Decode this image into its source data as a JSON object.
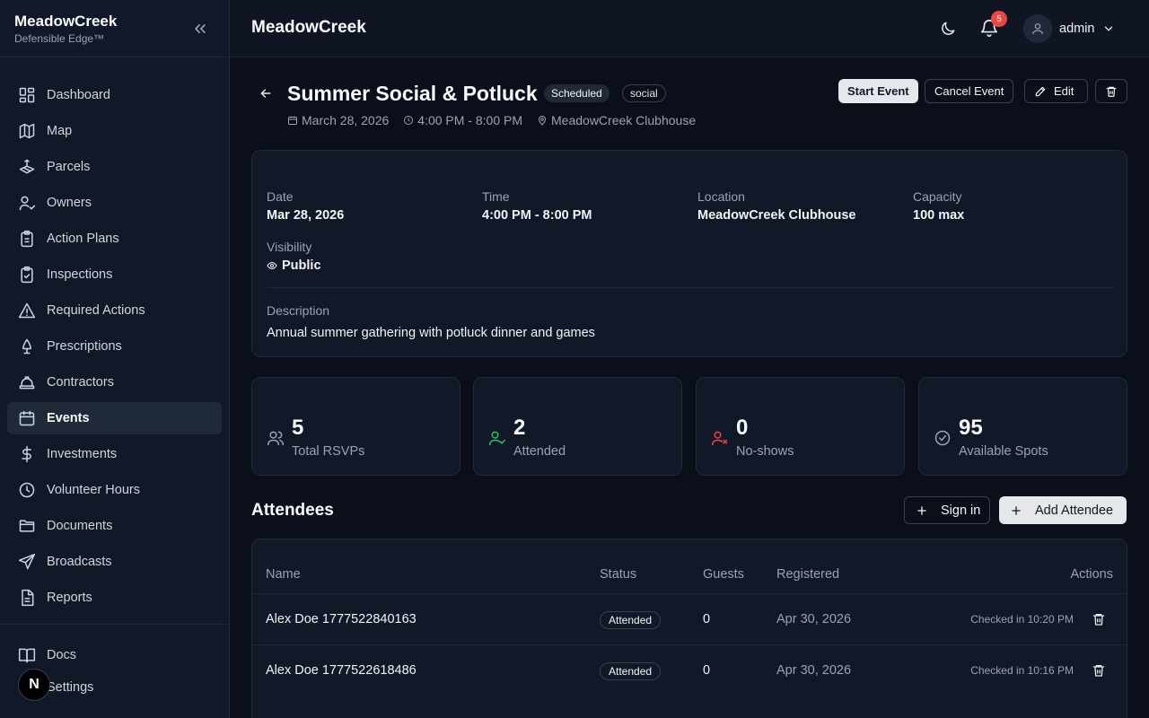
{
  "sidebar": {
    "brand": "MeadowCreek",
    "tagline": "Defensible Edge™",
    "items": [
      {
        "label": "Dashboard",
        "icon": "dashboard-icon"
      },
      {
        "label": "Map",
        "icon": "map-icon"
      },
      {
        "label": "Parcels",
        "icon": "parcels-icon"
      },
      {
        "label": "Owners",
        "icon": "owners-icon"
      },
      {
        "label": "Action Plans",
        "icon": "clipboard-icon"
      },
      {
        "label": "Inspections",
        "icon": "clipboard-check-icon"
      },
      {
        "label": "Required Actions",
        "icon": "warning-icon"
      },
      {
        "label": "Prescriptions",
        "icon": "tree-icon"
      },
      {
        "label": "Contractors",
        "icon": "hard-hat-icon"
      },
      {
        "label": "Events",
        "icon": "calendar-icon",
        "active": true
      },
      {
        "label": "Investments",
        "icon": "dollar-icon"
      },
      {
        "label": "Volunteer Hours",
        "icon": "clock-icon"
      },
      {
        "label": "Documents",
        "icon": "folder-icon"
      },
      {
        "label": "Broadcasts",
        "icon": "send-icon"
      },
      {
        "label": "Reports",
        "icon": "report-icon"
      }
    ],
    "bottom_items": [
      {
        "label": "Docs",
        "icon": "book-icon"
      },
      {
        "label": "Settings",
        "icon": "gear-icon"
      }
    ],
    "n_badge": "N"
  },
  "header": {
    "title": "MeadowCreek",
    "notification_count": "5",
    "user": "admin"
  },
  "event": {
    "title": "Summer Social & Potluck",
    "status": "Scheduled",
    "category": "social",
    "date": "March 28, 2026",
    "time": "4:00 PM - 8:00 PM",
    "location": "MeadowCreek Clubhouse",
    "actions": {
      "start": "Start Event",
      "cancel": "Cancel Event",
      "edit": "Edit"
    }
  },
  "details": {
    "date_label": "Date",
    "date_value": "Mar 28, 2026",
    "time_label": "Time",
    "time_value": "4:00 PM - 8:00 PM",
    "location_label": "Location",
    "location_value": "MeadowCreek Clubhouse",
    "capacity_label": "Capacity",
    "capacity_value": "100 max",
    "visibility_label": "Visibility",
    "visibility_value": "Public",
    "description_label": "Description",
    "description_value": "Annual summer gathering with potluck dinner and games"
  },
  "stats": [
    {
      "value": "5",
      "label": "Total RSVPs",
      "icon": "users-icon",
      "color": "#9ca3af"
    },
    {
      "value": "2",
      "label": "Attended",
      "icon": "user-check-icon",
      "color": "#22c55e"
    },
    {
      "value": "0",
      "label": "No-shows",
      "icon": "user-x-icon",
      "color": "#ef4444"
    },
    {
      "value": "95",
      "label": "Available Spots",
      "icon": "check-circle-icon",
      "color": "#9ca3af"
    }
  ],
  "attendees": {
    "title": "Attendees",
    "sign_in": "Sign in",
    "add": "Add Attendee",
    "columns": [
      "Name",
      "Status",
      "Guests",
      "Registered",
      "Actions"
    ],
    "rows": [
      {
        "name": "Alex Doe 1777522840163",
        "status": "Attended",
        "guests": "0",
        "registered": "Apr 30, 2026",
        "checked_in": "Checked in 10:20 PM"
      },
      {
        "name": "Alex Doe 1777522618486",
        "status": "Attended",
        "guests": "0",
        "registered": "Apr 30, 2026",
        "checked_in": "Checked in 10:16 PM"
      }
    ]
  }
}
